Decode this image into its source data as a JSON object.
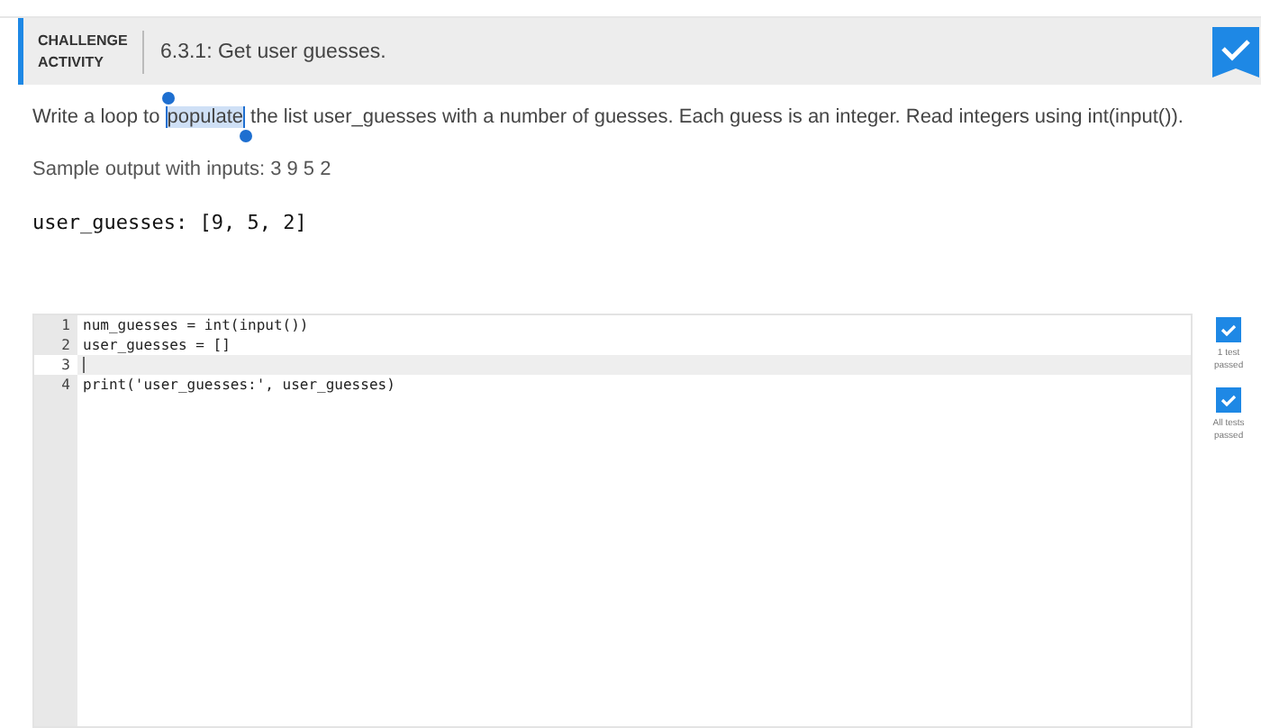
{
  "header": {
    "label": "CHALLENGE ACTIVITY",
    "title": "6.3.1: Get user guesses.",
    "completed": true
  },
  "description": {
    "before": "Write a loop to ",
    "selection": "populate",
    "after": " the list user_guesses with a number of guesses. Each guess is an integer. Read integers using int(input())."
  },
  "sample_label": "Sample output with inputs: 3 9 5 2",
  "sample_output": "user_guesses: [9, 5, 2]",
  "editor": {
    "lines": [
      {
        "number": "1",
        "code": "num_guesses = int(input())",
        "active": false
      },
      {
        "number": "2",
        "code": "user_guesses = []",
        "active": false
      },
      {
        "number": "3",
        "active": true
      },
      {
        "number": "4",
        "code": "print('user_guesses:', user_guesses)",
        "active": false
      }
    ]
  },
  "tests": [
    {
      "label": "1 test passed",
      "passed": true
    },
    {
      "label": "All tests passed",
      "passed": true
    }
  ]
}
